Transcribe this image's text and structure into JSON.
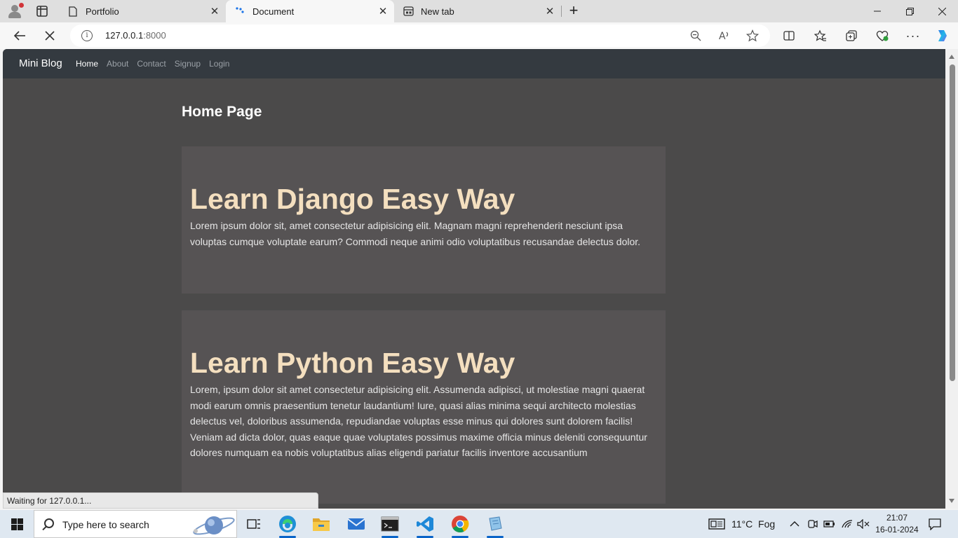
{
  "browser": {
    "tabs": [
      {
        "label": "Portfolio",
        "icon": "page-icon",
        "active": false
      },
      {
        "label": "Document",
        "icon": "loading-icon",
        "active": true
      },
      {
        "label": "New tab",
        "icon": "newtab-icon",
        "active": false
      }
    ],
    "address": {
      "host": "127.0.0.1",
      "port": ":8000"
    },
    "status_text": "Waiting for 127.0.0.1..."
  },
  "site": {
    "brand": "Mini Blog",
    "nav": [
      {
        "label": "Home",
        "active": true
      },
      {
        "label": "About",
        "active": false
      },
      {
        "label": "Contact",
        "active": false
      },
      {
        "label": "Signup",
        "active": false
      },
      {
        "label": "Login",
        "active": false
      }
    ],
    "page_title": "Home Page",
    "posts": [
      {
        "title": "Learn Django Easy Way",
        "body": "Lorem ipsum dolor sit, amet consectetur adipisicing elit. Magnam magni reprehenderit nesciunt ipsa voluptas cumque voluptate earum? Commodi neque animi odio voluptatibus recusandae delectus dolor."
      },
      {
        "title": "Learn Python Easy Way",
        "body": "Lorem, ipsum dolor sit amet consectetur adipisicing elit. Assumenda adipisci, ut molestiae magni quaerat modi earum omnis praesentium tenetur laudantium! Iure, quasi alias minima sequi architecto molestias delectus vel, doloribus assumenda, repudiandae voluptas esse minus qui dolores sunt dolorem facilis! Veniam ad dicta dolor, quas eaque quae voluptates possimus maxime officia minus deleniti consequuntur dolores numquam ea nobis voluptatibus alias eligendi pariatur facilis inventore accusantium"
      }
    ]
  },
  "taskbar": {
    "search_placeholder": "Type here to search",
    "weather": "11°C  Fog",
    "time": "21:07",
    "date": "16-01-2024"
  },
  "colors": {
    "page_bg": "#4b4a4a",
    "navbar_bg": "#343a40",
    "card_bg": "#565354",
    "post_title": "#f4dfbf"
  }
}
